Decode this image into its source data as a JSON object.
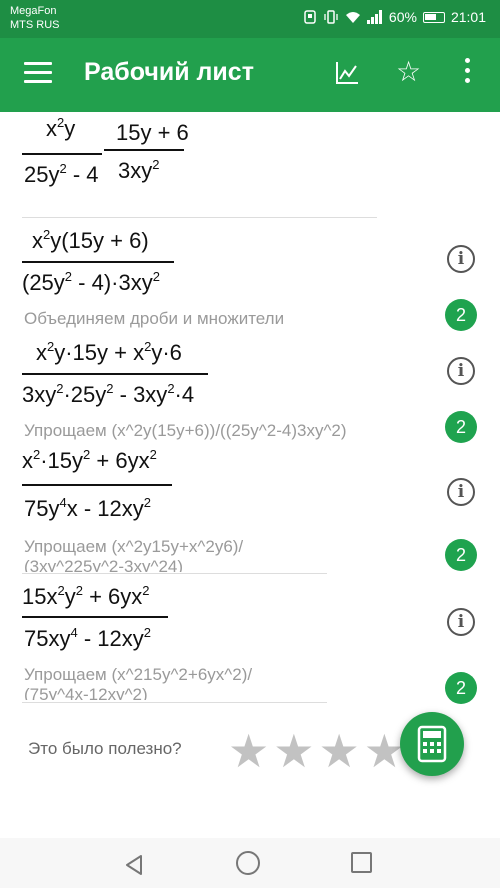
{
  "status_bar": {
    "carrier_line1": "MegaFon",
    "carrier_line2": "MTS RUS",
    "battery": "60%",
    "time": "21:01"
  },
  "app_bar": {
    "title": "Рабочий лист",
    "icons": [
      "menu-icon",
      "graph-icon",
      "star-icon",
      "more-vert-icon"
    ]
  },
  "worksheet": {
    "problem": {
      "frac1_num": "x²y",
      "frac1_den": "25y² - 4",
      "frac2_num": "15y + 6",
      "frac2_den": "3xy²"
    },
    "steps": [
      {
        "num": "x²y(15y + 6)",
        "den": "(25y² - 4)·3xy²",
        "caption": "Объединяем дроби и множители",
        "badge": "2"
      },
      {
        "num": "x²y·15y + x²y·6",
        "den": "3xy²·25y² - 3xy²·4",
        "caption": "Упрощаем (x^2y(15y+6))/((25y^2-4)3xy^2)",
        "badge": "2"
      },
      {
        "num": "x²·15y² + 6yx²",
        "den": "75y⁴x - 12xy²",
        "caption_line1": "Упрощаем (x^2y15y+x^2y6)/",
        "caption_line2": "(3xy^225y^2-3xy^24)",
        "badge": "2"
      },
      {
        "num": "15x²y² + 6yx²",
        "den": "75xy⁴ - 12xy²",
        "caption_line1": "Упрощаем (x^215y^2+6yx^2)/",
        "caption_line2": "(75y^4x-12xy^2)",
        "badge": "2"
      }
    ]
  },
  "feedback": {
    "question": "Это было полезно?",
    "stars": "★★★★★"
  },
  "colors": {
    "status_bar": "#1e8e44",
    "app_bar": "#22a04d",
    "badge": "#1fa34f"
  }
}
